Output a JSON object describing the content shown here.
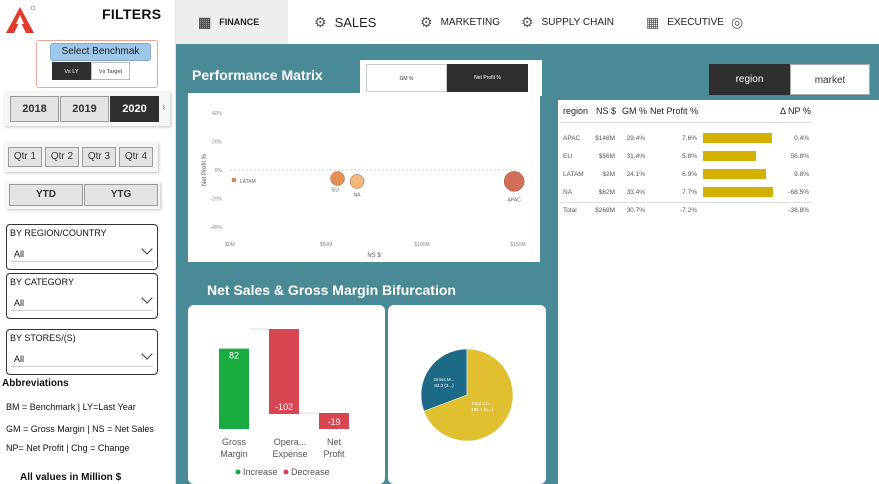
{
  "sidebar": {
    "title": "FILTERS",
    "benchmark_button": "Select Benchmak (BM)",
    "benchmark_options": [
      "Vs LY",
      "Vs Target"
    ],
    "years": [
      "2018",
      "2019",
      "2020"
    ],
    "active_year": "2020",
    "quarters": [
      "Qtr 1",
      "Qtr 2",
      "Qtr 3",
      "Qtr 4"
    ],
    "periods": [
      "YTD",
      "YTG"
    ],
    "slicers": [
      {
        "label": "BY REGION/COUNTRY",
        "value": "All"
      },
      {
        "label": "BY CATEGORY",
        "value": "All"
      },
      {
        "label": "BY STORES/(S)",
        "value": "All"
      }
    ],
    "abbr_title": "Abbreviations",
    "abbr_lines": [
      "BM = Benchmark | LY=Last Year",
      "GM = Gross Margin | NS = Net Sales",
      "NP= Net Profit | Chg = Change"
    ],
    "all_values": "All values in Million $"
  },
  "nav": {
    "finance": "FINANCE",
    "sales": "SALES",
    "marketing": "MARKETING",
    "supply_chain": "SUPPLY CHAIN",
    "executive": "EXECUTIVE"
  },
  "performance": {
    "title": "Performance Matrix",
    "tabs": [
      "GM %",
      "Net Profit %"
    ],
    "active_tab": "Net Profit %"
  },
  "nsgm": {
    "title": "Net Sales & Gross Margin Bifurcation"
  },
  "toggle": {
    "options": [
      "region",
      "market"
    ],
    "active": "region"
  },
  "table": {
    "headers": [
      "region",
      "NS $",
      "GM %",
      "Net Profit %",
      "Δ NP %"
    ],
    "rows": [
      {
        "region": "APAC",
        "ns": "$148M",
        "gm": "29.4%",
        "np": "7.6%",
        "np_value": 7.6,
        "chg": "0.4%"
      },
      {
        "region": "EU",
        "ns": "$56M",
        "gm": "31.4%",
        "np": "5.8%",
        "np_value": 5.8,
        "chg": "56.8%"
      },
      {
        "region": "LATAM",
        "ns": "$2M",
        "gm": "24.1%",
        "np": "6.9%",
        "np_value": 6.9,
        "chg": "9.8%"
      },
      {
        "region": "NA",
        "ns": "$62M",
        "gm": "33.4%",
        "np": "7.7%",
        "np_value": 7.7,
        "chg": "-68.5%"
      }
    ],
    "total": {
      "region": "Total",
      "ns": "$268M",
      "gm": "30.7%",
      "np": "-7.2%",
      "chg": "-38.8%"
    },
    "bar_color": "#d4b000"
  },
  "chart_data": [
    {
      "type": "scatter",
      "title": "",
      "xlabel": "NS $",
      "ylabel": "Net Profit %",
      "x_ticks": [
        "$0M",
        "$50M",
        "$100M",
        "$150M"
      ],
      "y_ticks": [
        "40%",
        "20%",
        "0%",
        "-20%",
        "-40%"
      ],
      "xlim": [
        0,
        150
      ],
      "ylim": [
        -40,
        40
      ],
      "points": [
        {
          "label": "LATAM",
          "x": 2,
          "y": -7,
          "color": "#e07b39"
        },
        {
          "label": "EU",
          "x": 56,
          "y": -6,
          "color": "#e07b39"
        },
        {
          "label": "NA",
          "x": 62,
          "y": -8,
          "color": "#f0a968"
        },
        {
          "label": "APAC",
          "x": 148,
          "y": -8,
          "color": "#c8553a"
        }
      ]
    },
    {
      "type": "bar",
      "subtype": "waterfall",
      "categories": [
        "Gross Margin",
        "Opera... Expense",
        "Net Profit"
      ],
      "values": [
        82,
        -102,
        -19
      ],
      "value_labels": [
        "82",
        "-102",
        "-19"
      ],
      "colors": {
        "increase": "#1aab40",
        "decrease": "#d64550"
      },
      "legend": [
        {
          "name": "Increase",
          "color": "#1aab40"
        },
        {
          "name": "Decrease",
          "color": "#d64550"
        }
      ]
    },
    {
      "type": "pie",
      "slices": [
        {
          "label": "Gross M...",
          "value_label": "82.3 (3...)",
          "value": 82.3,
          "color": "#1d6a86"
        },
        {
          "label": "Total CO...",
          "value_label": "185.7 (6...)",
          "value": 185.7,
          "color": "#e0bf30"
        }
      ]
    }
  ]
}
